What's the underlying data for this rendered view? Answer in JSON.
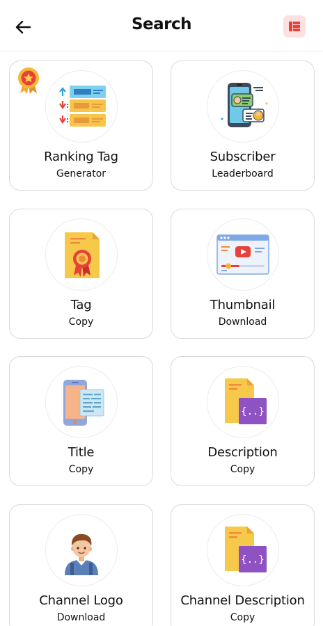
{
  "header": {
    "title": "Search",
    "back_icon": "arrow-left-icon",
    "menu_icon": "menu-icon",
    "menu_bg": "#fde0e0",
    "menu_accent": "#e8403a"
  },
  "tools": [
    {
      "line1": "Ranking Tag",
      "line2": "Generator",
      "icon": "ranking-tags-icon"
    },
    {
      "line1": "Subscriber",
      "line2": "Leaderboard",
      "icon": "subscriber-phone-icon"
    },
    {
      "line1": "Tag",
      "line2": "Copy",
      "icon": "certificate-icon"
    },
    {
      "line1": "Thumbnail",
      "line2": "Download",
      "icon": "video-player-icon"
    },
    {
      "line1": "Title",
      "line2": "Copy",
      "icon": "phone-doc-icon"
    },
    {
      "line1": "Description",
      "line2": "Copy",
      "icon": "code-file-icon"
    },
    {
      "line1": "Channel Logo",
      "line2": "Download",
      "icon": "person-avatar-icon"
    },
    {
      "line1": "Channel Description",
      "line2": "Copy",
      "icon": "code-file-icon"
    }
  ],
  "badge_icon": "award-medal-icon"
}
